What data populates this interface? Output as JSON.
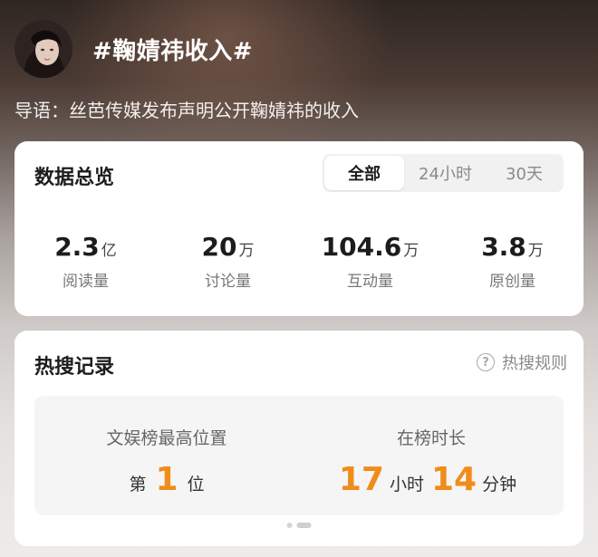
{
  "header": {
    "title": "#鞠婧祎收入#",
    "intro": "导语：丝芭传媒发布声明公开鞠婧祎的收入",
    "avatar_icon": "user-avatar"
  },
  "overview": {
    "title": "数据总览",
    "tabs": [
      {
        "label": "全部",
        "active": true
      },
      {
        "label": "24小时",
        "active": false
      },
      {
        "label": "30天",
        "active": false
      }
    ],
    "stats": [
      {
        "value": "2.3",
        "unit": "亿",
        "label": "阅读量"
      },
      {
        "value": "20",
        "unit": "万",
        "label": "讨论量"
      },
      {
        "value": "104.6",
        "unit": "万",
        "label": "互动量"
      },
      {
        "value": "3.8",
        "unit": "万",
        "label": "原创量"
      }
    ]
  },
  "hot_search": {
    "title": "热搜记录",
    "rules_label": "热搜规则",
    "rules_icon": "question-circle-icon",
    "rank": {
      "label": "文娱榜最高位置",
      "prefix": "第",
      "value": "1",
      "suffix": "位"
    },
    "duration": {
      "label": "在榜时长",
      "hours": "17",
      "hours_unit": "小时",
      "minutes": "14",
      "minutes_unit": "分钟"
    },
    "accent_color": "#f08c1a"
  }
}
